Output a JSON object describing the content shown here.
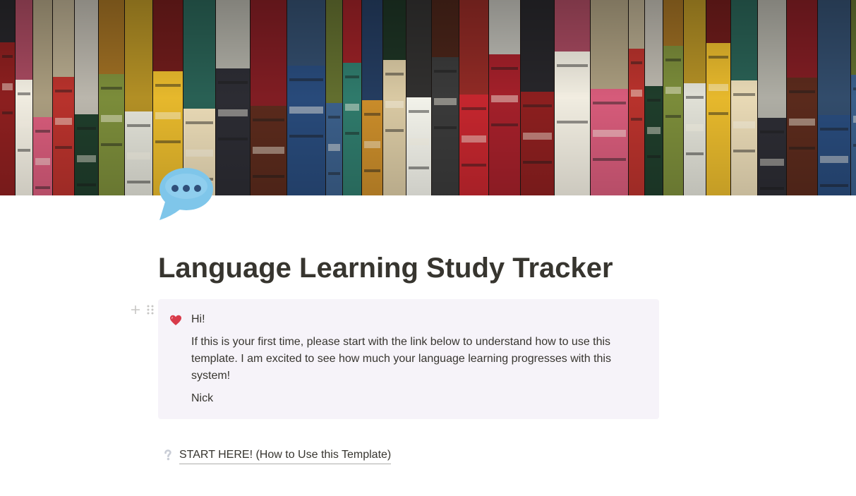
{
  "cover": {
    "description_icon": "bookshelf-cover-image"
  },
  "page": {
    "icon": "speech-bubble-icon",
    "title": "Language Learning Study Tracker"
  },
  "callout": {
    "icon": "heart-icon",
    "greeting": "Hi!",
    "message": "If this is your first time, please start with the link below to understand how to use this template.  I am excited to see how much your language learning progresses with this system!",
    "signature": "Nick",
    "background": "#f6f3f9"
  },
  "link": {
    "icon": "question-mark-icon",
    "text": "START HERE! (How to Use this Template)"
  },
  "colors": {
    "text": "#37352f",
    "bubble": "#7fc6ea",
    "heart": "#d83a4a"
  }
}
